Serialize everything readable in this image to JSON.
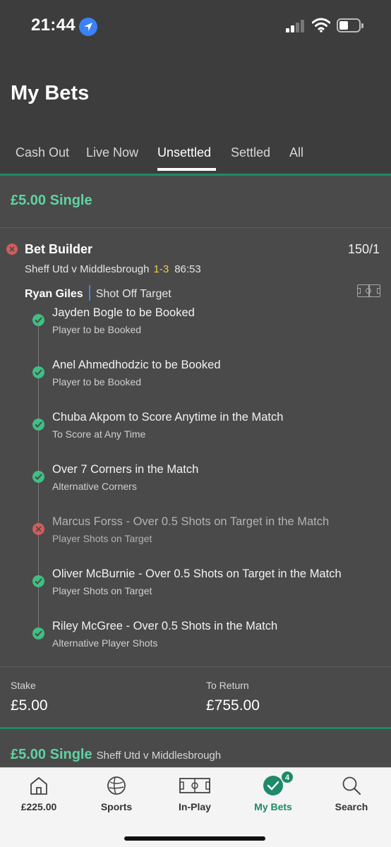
{
  "status_bar": {
    "time": "21:44",
    "icons": [
      "location-arrow-icon",
      "cellular-signal-icon",
      "wifi-icon",
      "battery-icon"
    ]
  },
  "header": {
    "title": "My Bets",
    "tabs": [
      {
        "label": "Cash Out",
        "active": false
      },
      {
        "label": "Live Now",
        "active": false
      },
      {
        "label": "Unsettled",
        "active": true
      },
      {
        "label": "Settled",
        "active": false
      },
      {
        "label": "All",
        "active": false
      }
    ]
  },
  "bet": {
    "title": "£5.00 Single",
    "type": "Bet Builder",
    "odds": "150/1",
    "match": "Sheff Utd v Middlesbrough",
    "score": "1-3",
    "clock": "86:53",
    "player": "Ryan Giles",
    "player_market": "Shot Off Target",
    "legs": [
      {
        "title": "Jayden Bogle to be Booked",
        "subtitle": "Player to be Booked",
        "status": "won"
      },
      {
        "title": "Anel Ahmedhodzic to be Booked",
        "subtitle": "Player to be Booked",
        "status": "won"
      },
      {
        "title": "Chuba Akpom to Score Anytime in the Match",
        "subtitle": "To Score at Any Time",
        "status": "won"
      },
      {
        "title": "Over 7 Corners in the Match",
        "subtitle": "Alternative Corners",
        "status": "won"
      },
      {
        "title": "Marcus Forss - Over 0.5 Shots on Target in the Match",
        "subtitle": "Player Shots on Target",
        "status": "lost"
      },
      {
        "title": "Oliver McBurnie - Over 0.5 Shots on Target in the Match",
        "subtitle": "Player Shots on Target",
        "status": "won"
      },
      {
        "title": "Riley McGree - Over 0.5 Shots in the Match",
        "subtitle": "Alternative Player Shots",
        "status": "won"
      }
    ],
    "stake_label": "Stake",
    "stake": "£5.00",
    "return_label": "To Return",
    "return": "£755.00"
  },
  "next_bet": {
    "title": "£5.00 Single",
    "match": "Sheff Utd v Middlesbrough"
  },
  "bottom_nav": {
    "items": [
      {
        "label": "£225.00",
        "icon": "home-icon"
      },
      {
        "label": "Sports",
        "icon": "football-icon"
      },
      {
        "label": "In-Play",
        "icon": "pitch-icon"
      },
      {
        "label": "My Bets",
        "icon": "checkmark-circle-icon",
        "badge": "4",
        "active": true
      },
      {
        "label": "Search",
        "icon": "search-icon"
      }
    ]
  },
  "colors": {
    "accent_green": "#1d8a69",
    "title_green": "#5fd3a1",
    "score_yellow": "#f2c94c",
    "lost_red": "#d25c5c"
  }
}
